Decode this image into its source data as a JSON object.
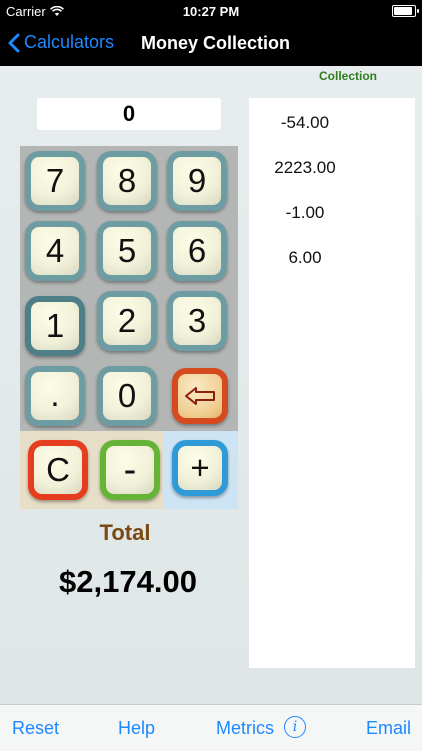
{
  "status_bar": {
    "carrier": "Carrier",
    "time": "10:27 PM",
    "battery_level": 1.0
  },
  "nav": {
    "back_label": "Calculators",
    "title": "Money Collection"
  },
  "collection": {
    "label": "Collection",
    "items": [
      "-54.00",
      "2223.00",
      "-1.00",
      "6.00"
    ]
  },
  "display": {
    "value": "0"
  },
  "keypad": {
    "row1": [
      "7",
      "8",
      "9"
    ],
    "row2": [
      "4",
      "5",
      "6"
    ],
    "row3": [
      "1",
      "2",
      "3"
    ],
    "dot": ".",
    "zero": "0",
    "backspace_icon": "left-arrow-icon"
  },
  "operations": {
    "clear": "C",
    "minus": "-",
    "plus": "+"
  },
  "total": {
    "label": "Total",
    "value": "$2,174.00"
  },
  "toolbar": {
    "reset": "Reset",
    "help": "Help",
    "metrics": "Metrics",
    "info_icon": "info-icon",
    "email": "Email"
  },
  "colors": {
    "accent": "#1e88ff",
    "total_label": "#7b4a12",
    "collection_label": "#2f7d1d"
  }
}
